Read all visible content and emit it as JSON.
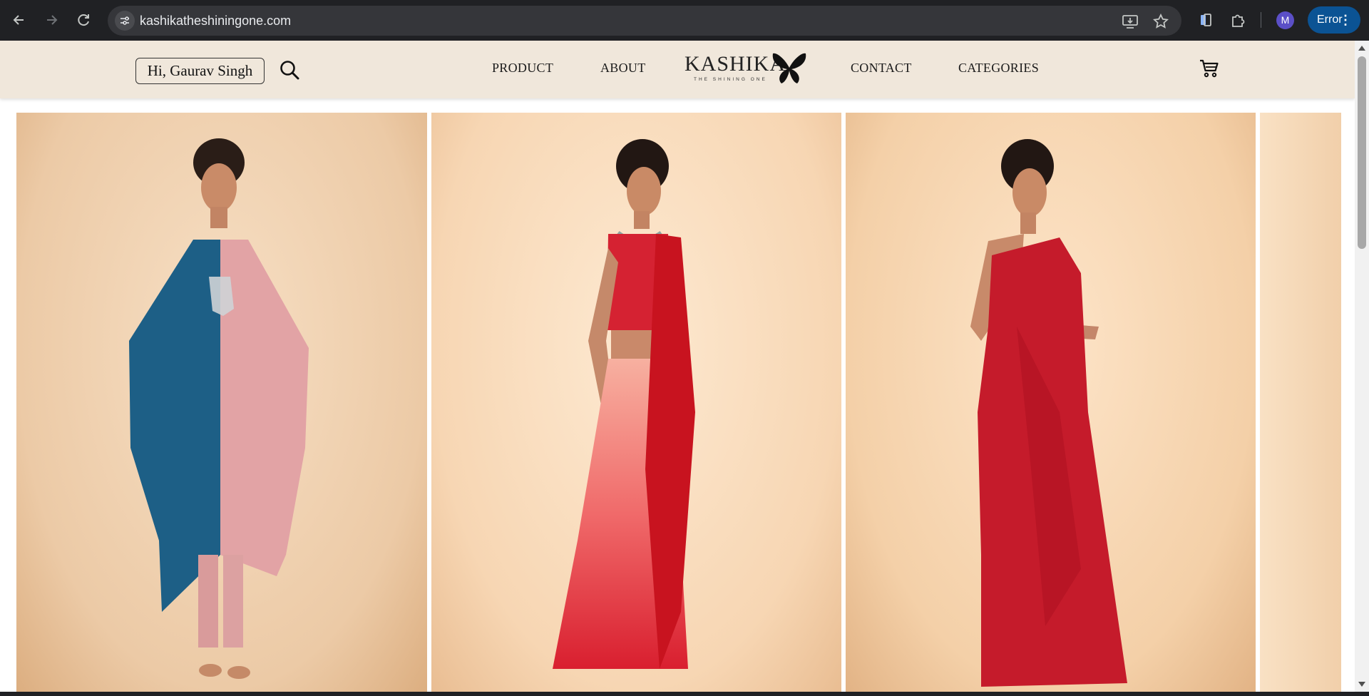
{
  "browser": {
    "url": "kashikatheshiningone.com",
    "profile_initial": "M",
    "error_label": "Error",
    "icons": [
      "back-arrow-icon",
      "forward-arrow-icon",
      "reload-icon",
      "site-settings-icon",
      "install-app-icon",
      "bookmark-star-icon",
      "side-panel-icon",
      "extensions-icon",
      "more-menu-icon"
    ]
  },
  "header": {
    "greeting": "Hi, Gaurav Singh",
    "nav": {
      "product": "PRODUCT",
      "about": "ABOUT",
      "contact": "CONTACT",
      "categories": "CATEGORIES"
    },
    "logo": {
      "name": "KASHIKA",
      "tagline": "THE SHINING ONE"
    }
  },
  "gallery": {
    "items": [
      {
        "alt": "blue-pink-kaftan-set",
        "colors": [
          "#1d5f86",
          "#e2a3a5"
        ]
      },
      {
        "alt": "red-ombre-saree",
        "colors": [
          "#d91f2f",
          "#f6a79a"
        ]
      },
      {
        "alt": "red-draped-gown",
        "colors": [
          "#c51b2b"
        ]
      },
      {
        "alt": "partial-next-image",
        "colors": [
          "#f5d6b4"
        ]
      }
    ]
  },
  "colors": {
    "header_bg": "#f0e7db",
    "chrome_bg": "#202124",
    "error_btn": "#0b5394"
  }
}
